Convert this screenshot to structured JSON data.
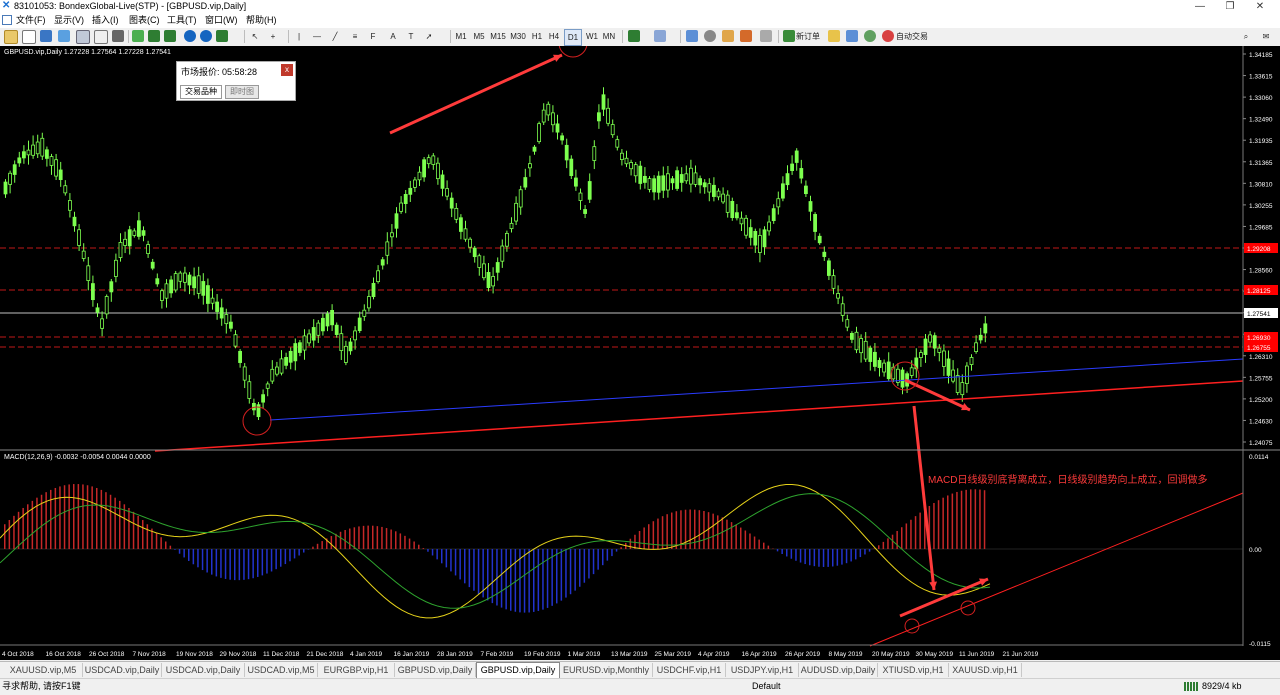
{
  "window": {
    "title": "83101053: BondexGlobal-Live(STP) - [GBPUSD.vip,Daily]",
    "minimize": "—",
    "maximize": "❐",
    "close": "✕"
  },
  "menu": [
    "文件(F)",
    "显示(V)",
    "插入(I)",
    "图表(C)",
    "工具(T)",
    "窗口(W)",
    "帮助(H)"
  ],
  "toolbar": {
    "timeframes": [
      "M1",
      "M5",
      "M15",
      "M30",
      "H1",
      "H4",
      "D1",
      "W1",
      "MN"
    ],
    "new_order": "新订单",
    "auto_trading": "自动交易",
    "text_tool": "A"
  },
  "chart": {
    "symbol_info": "GBPUSD.vip,Daily  1.27228 1.27564 1.27228 1.27541",
    "macd_info": "MACD(12,26,9) -0.0032 -0.0054 0.0044 0.0000",
    "annotation": "MACD日线级别底背离成立，日线级别趋势向上成立，回调做多",
    "price_labels": [
      "1.34185",
      "1.33615",
      "1.33060",
      "1.32490",
      "1.31935",
      "1.31365",
      "1.30810",
      "1.30255",
      "1.29685",
      "1.29130",
      "1.28560",
      "1.28005",
      "1.27435",
      "1.26880",
      "1.26310",
      "1.25755",
      "1.25200",
      "1.24630",
      "1.24075"
    ],
    "highlight_prices": [
      {
        "text": "1.29208",
        "color": "#ff0000"
      },
      {
        "text": "1.28125",
        "color": "#ff0000"
      },
      {
        "text": "1.27541",
        "color": "#ffffff"
      },
      {
        "text": "1.26930",
        "color": "#ff0000"
      },
      {
        "text": "1.26755",
        "color": "#ff0000"
      }
    ],
    "macd_labels": [
      "0.0114",
      "0.00",
      "-0.0115"
    ],
    "dates": [
      "4 Oct 2018",
      "16 Oct 2018",
      "26 Oct 2018",
      "7 Nov 2018",
      "19 Nov 2018",
      "29 Nov 2018",
      "11 Dec 2018",
      "21 Dec 2018",
      "4 Jan 2019",
      "16 Jan 2019",
      "28 Jan 2019",
      "7 Feb 2019",
      "19 Feb 2019",
      "1 Mar 2019",
      "13 Mar 2019",
      "25 Mar 2019",
      "4 Apr 2019",
      "16 Apr 2019",
      "26 Apr 2019",
      "8 May 2019",
      "20 May 2019",
      "30 May 2019",
      "11 Jun 2019",
      "21 Jun 2019"
    ],
    "colors": {
      "bull": "#7dff4f",
      "bear": "#000000",
      "support": "#ff2020",
      "trend": "#2a3cff",
      "signal": "#ff3b3b"
    }
  },
  "quote_window": {
    "title": "市场报价: 05:58:28",
    "close": "x",
    "tabs": [
      "交易品种",
      "即时图"
    ]
  },
  "tabs": [
    "XAUUSD.vip,M5",
    "USDCAD.vip,Daily",
    "USDCAD.vip,Daily",
    "USDCAD.vip,M5",
    "EURGBP.vip,H1",
    "GBPUSD.vip,Daily",
    "GBPUSD.vip,Daily",
    "EURUSD.vip,Monthly",
    "USDCHF.vip,H1",
    "USDJPY.vip,H1",
    "AUDUSD.vip,Daily",
    "XTIUSD.vip,H1",
    "XAUUSD.vip,H1"
  ],
  "active_tab_index": 6,
  "status": {
    "help": "寻求帮助, 请按F1键",
    "profile": "Default",
    "traffic": "8929/4 kb"
  }
}
